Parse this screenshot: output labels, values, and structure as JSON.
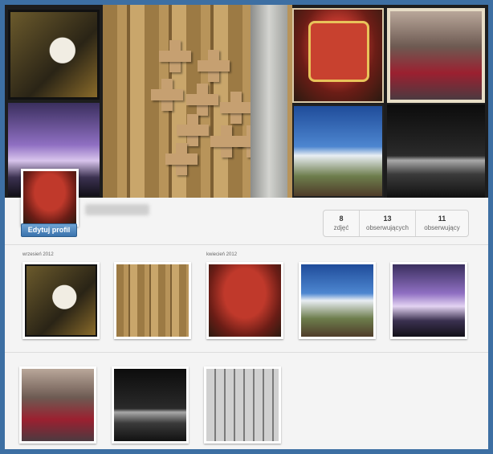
{
  "profile": {
    "edit_button": "Edytuj profil",
    "username": "••••••••••"
  },
  "stats": {
    "photos": {
      "count": "8",
      "label": "zdjęć"
    },
    "followers": {
      "count": "13",
      "label": "obserwujących"
    },
    "following": {
      "count": "11",
      "label": "obserwujący"
    }
  },
  "months": {
    "september": "wrzesień 2012",
    "april": "kwiecień 2012"
  }
}
